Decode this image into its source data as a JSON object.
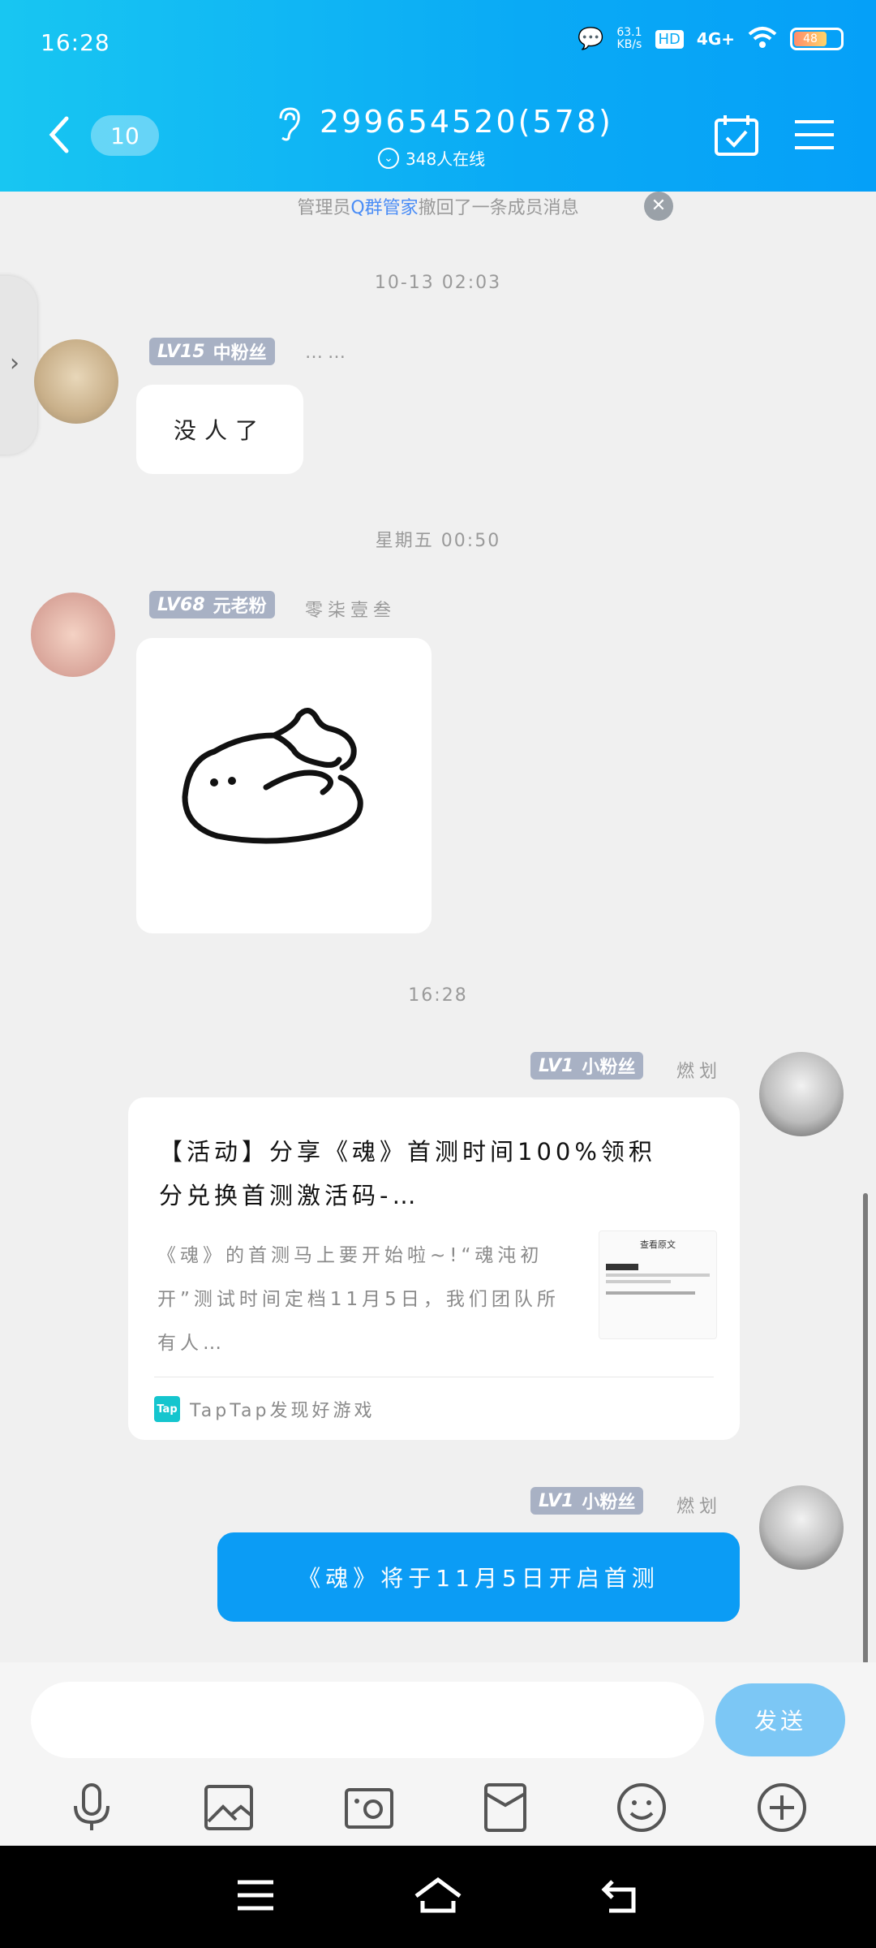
{
  "status_bar": {
    "time": "16:28",
    "net_speed": "63.1\nKB/s",
    "network": "4G+",
    "battery": "48"
  },
  "header": {
    "unread_count": "10",
    "group_title": "299654520(578)",
    "online_text": "348人在线"
  },
  "notice": {
    "prefix": "管理员",
    "highlight": "Q群管家",
    "suffix": "撤回了一条成员消息"
  },
  "messages": [
    {
      "timestamp": "10-13 02:03",
      "level": "LV15",
      "badge_title": "中粉丝",
      "nickname": "……",
      "text": "没人了"
    },
    {
      "timestamp": "星期五 00:50",
      "level": "LV68",
      "badge_title": "元老粉",
      "nickname": "零柒壹叁"
    },
    {
      "timestamp": "16:28",
      "level": "LV1",
      "badge_title": "小粉丝",
      "nickname": "燃划",
      "card": {
        "title": "【活动】分享《魂》首测时间100%领积分兑换首测激活码-…",
        "desc": "《魂》的首测马上要开始啦~!“魂沌初开”测试时间定档11月5日，我们团队所有人…",
        "thumb_label": "查看原文",
        "source_logo": "Tap",
        "source": "TapTap发现好游戏"
      }
    },
    {
      "level": "LV1",
      "badge_title": "小粉丝",
      "nickname": "燃划",
      "text": "《魂》将于11月5日开启首测"
    }
  ],
  "input": {
    "placeholder": "",
    "send_label": "发送"
  },
  "toolbar": {
    "icons": [
      "microphone-icon",
      "image-icon",
      "camera-icon",
      "red-packet-icon",
      "emoji-icon",
      "plus-icon"
    ]
  }
}
